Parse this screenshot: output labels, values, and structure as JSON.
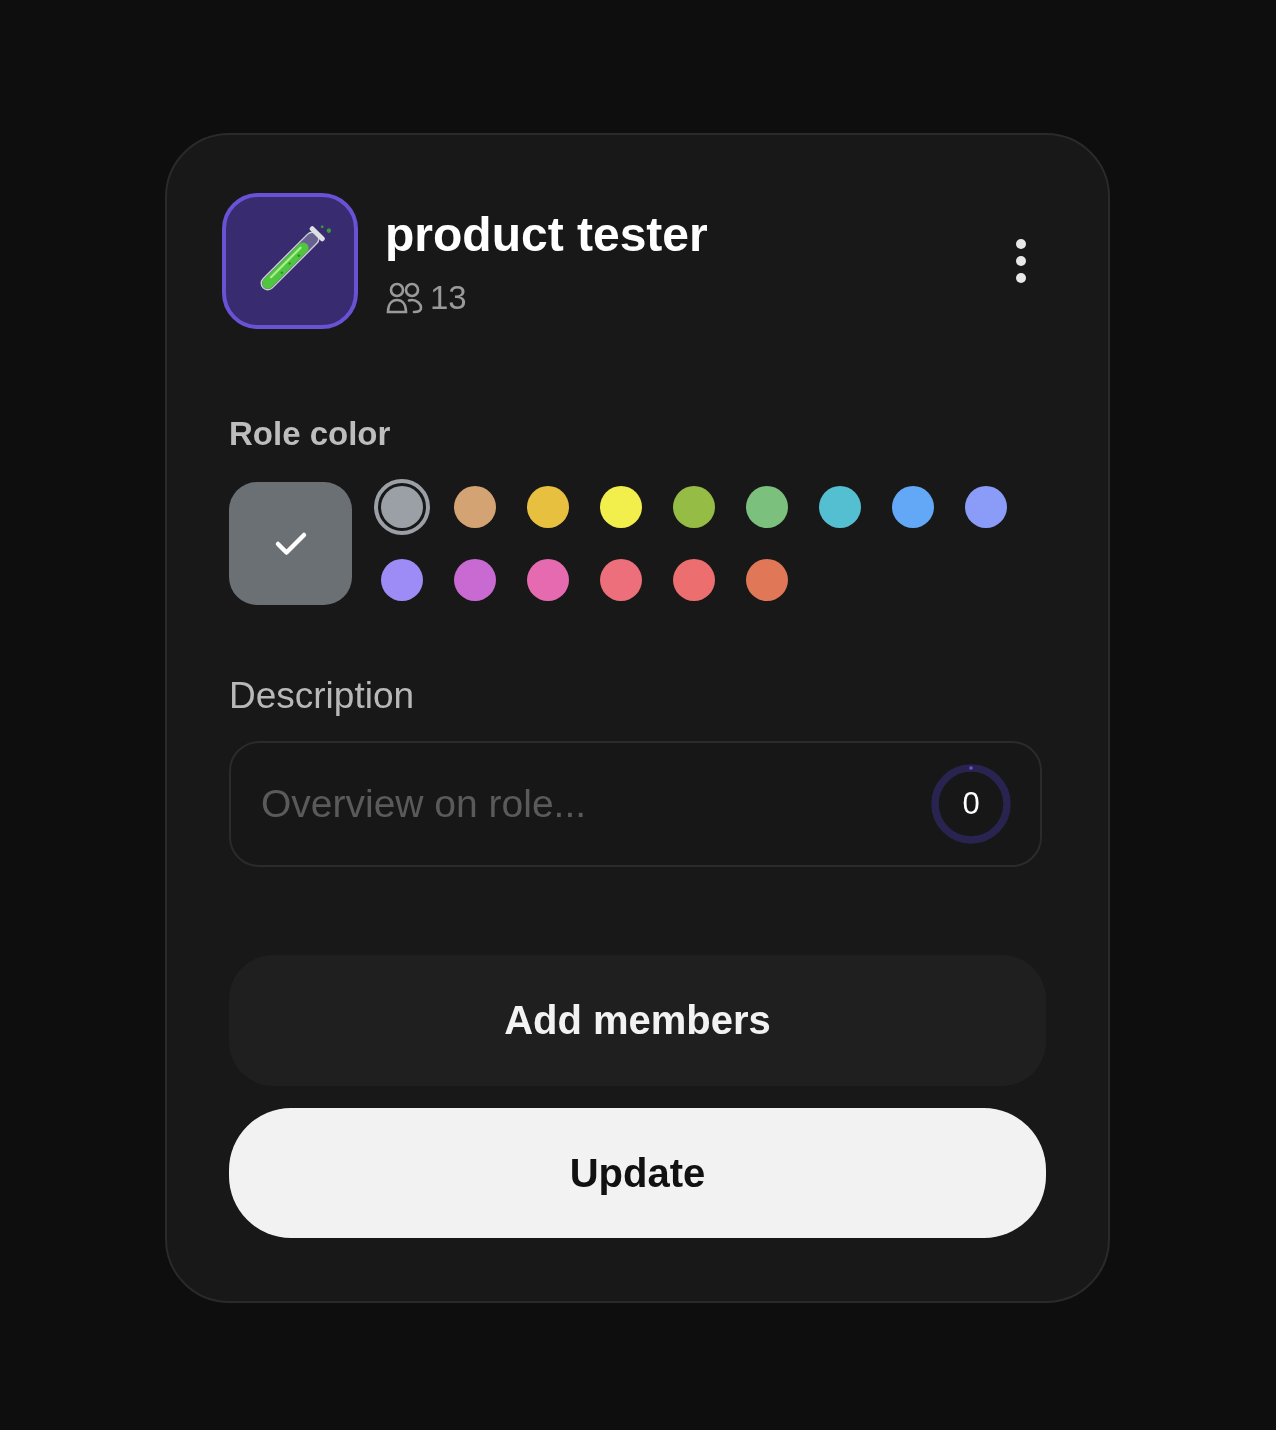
{
  "role": {
    "name": "product tester",
    "member_count": "13"
  },
  "role_color": {
    "label": "Role color",
    "default_swatch": {
      "color": "#6b7075",
      "checked": true
    },
    "swatches": [
      {
        "color": "#9aa0a6",
        "selected": true
      },
      {
        "color": "#d4a373",
        "selected": false
      },
      {
        "color": "#e8c040",
        "selected": false
      },
      {
        "color": "#f2ee4c",
        "selected": false
      },
      {
        "color": "#95bd45",
        "selected": false
      },
      {
        "color": "#7bc07d",
        "selected": false
      },
      {
        "color": "#55bfd2",
        "selected": false
      },
      {
        "color": "#63a8f6",
        "selected": false
      },
      {
        "color": "#8a9cf8",
        "selected": false
      },
      {
        "color": "#9d8cf5",
        "selected": false
      },
      {
        "color": "#c96ad2",
        "selected": false
      },
      {
        "color": "#e66aaf",
        "selected": false
      },
      {
        "color": "#ed6f7b",
        "selected": false
      },
      {
        "color": "#ed6e6f",
        "selected": false
      },
      {
        "color": "#e07858",
        "selected": false
      }
    ]
  },
  "description": {
    "label": "Description",
    "placeholder": "Overview on role...",
    "counter": {
      "text": "0",
      "level": 0
    }
  },
  "buttons": [
    {
      "label": "Add members",
      "kind": "secondary"
    },
    {
      "label": "Update",
      "kind": "primary"
    }
  ]
}
